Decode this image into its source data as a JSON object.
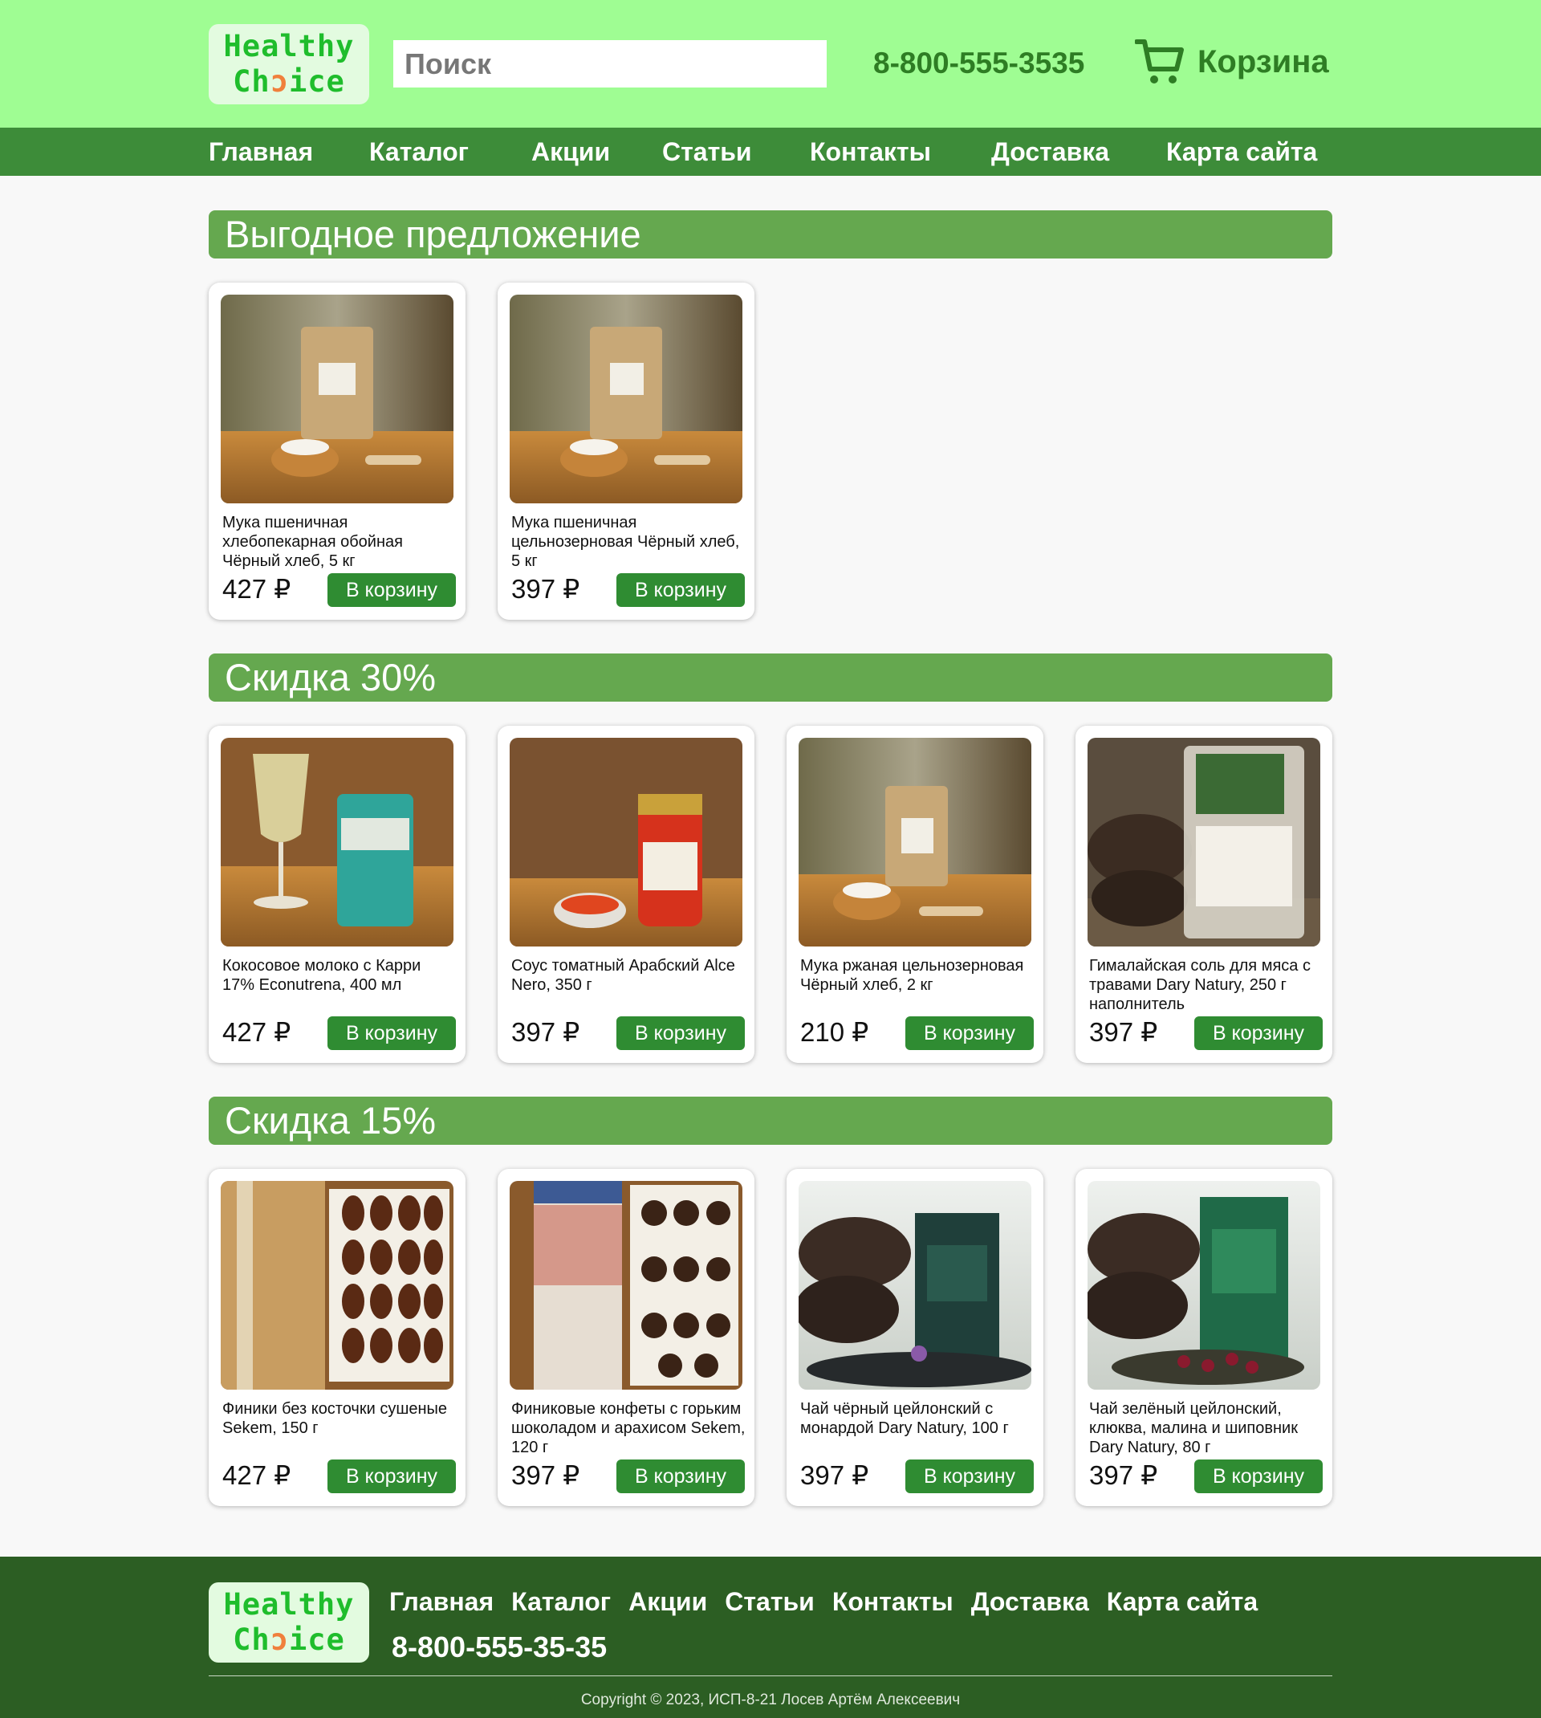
{
  "header": {
    "logo_line1": "Healthy",
    "logo_line2_a": "Ch",
    "logo_line2_b": "ice",
    "search_placeholder": "Поиск",
    "phone": "8-800-555-3535",
    "cart_label": "Корзина"
  },
  "nav": [
    "Главная",
    "Каталог",
    "Акции",
    "Статьи",
    "Контакты",
    "Доставка",
    "Карта сайта"
  ],
  "sections": [
    {
      "title": "Выгодное предложение",
      "products": [
        {
          "name": "Мука пшеничная хлебопекарная обойная Чёрный хлеб, 5 кг",
          "price": "427 ₽",
          "button": "В корзину",
          "icon": "flour-bag-photo"
        },
        {
          "name": "Мука пшеничная цельнозерновая Чёрный хлеб, 5 кг",
          "price": "397 ₽",
          "button": "В корзину",
          "icon": "flour-bag-photo"
        }
      ]
    },
    {
      "title": "Скидка 30%",
      "products": [
        {
          "name": "Кокосовое молоко с Карри 17% Econutrena, 400 мл",
          "price": "427 ₽",
          "button": "В корзину",
          "icon": "coconut-milk-photo"
        },
        {
          "name": "Соус томатный Арабский Alce Nero, 350 г",
          "price": "397 ₽",
          "button": "В корзину",
          "icon": "tomato-sauce-photo"
        },
        {
          "name": "Мука ржаная цельнозерновая Чёрный хлеб, 2 кг",
          "price": "210 ₽",
          "button": "В корзину",
          "icon": "flour-bag-photo"
        },
        {
          "name": "Гималайская соль для мяса с травами Dary Natury, 250 г наполнитель",
          "price": "397 ₽",
          "button": "В корзину",
          "icon": "salt-pack-photo"
        }
      ]
    },
    {
      "title": "Скидка 15%",
      "products": [
        {
          "name": "Финики без косточки сушеные Sekem, 150 г",
          "price": "427 ₽",
          "button": "В корзину",
          "icon": "dates-box-photo"
        },
        {
          "name": "Финиковые конфеты с горьким шоколадом и арахисом Sekem, 120 г",
          "price": "397 ₽",
          "button": "В корзину",
          "icon": "date-bites-photo"
        },
        {
          "name": "Чай чёрный цейлонский с монардой Dary Natury, 100 г",
          "price": "397 ₽",
          "button": "В корзину",
          "icon": "black-tea-photo"
        },
        {
          "name": "Чай зелёный цейлонский, клюква, малина и шиповник Dary Natury, 80 г",
          "price": "397 ₽",
          "button": "В корзину",
          "icon": "green-tea-photo"
        }
      ]
    }
  ],
  "footer": {
    "nav": [
      "Главная",
      "Каталог",
      "Акции",
      "Статьи",
      "Контакты",
      "Доставка",
      "Карта сайта"
    ],
    "phone": "8-800-555-35-35",
    "copyright": "Copyright © 2023, ИСП-8-21 Лосев Артём Алексеевич"
  },
  "colors": {
    "header_bg": "#9ffd93",
    "nav_bg": "#3d8c39",
    "section_title_bg": "#65a84f",
    "button_bg": "#2f8c32",
    "footer_bg": "#2c5e23",
    "logo_green": "#1fbd2c",
    "logo_orange": "#f0803c"
  }
}
